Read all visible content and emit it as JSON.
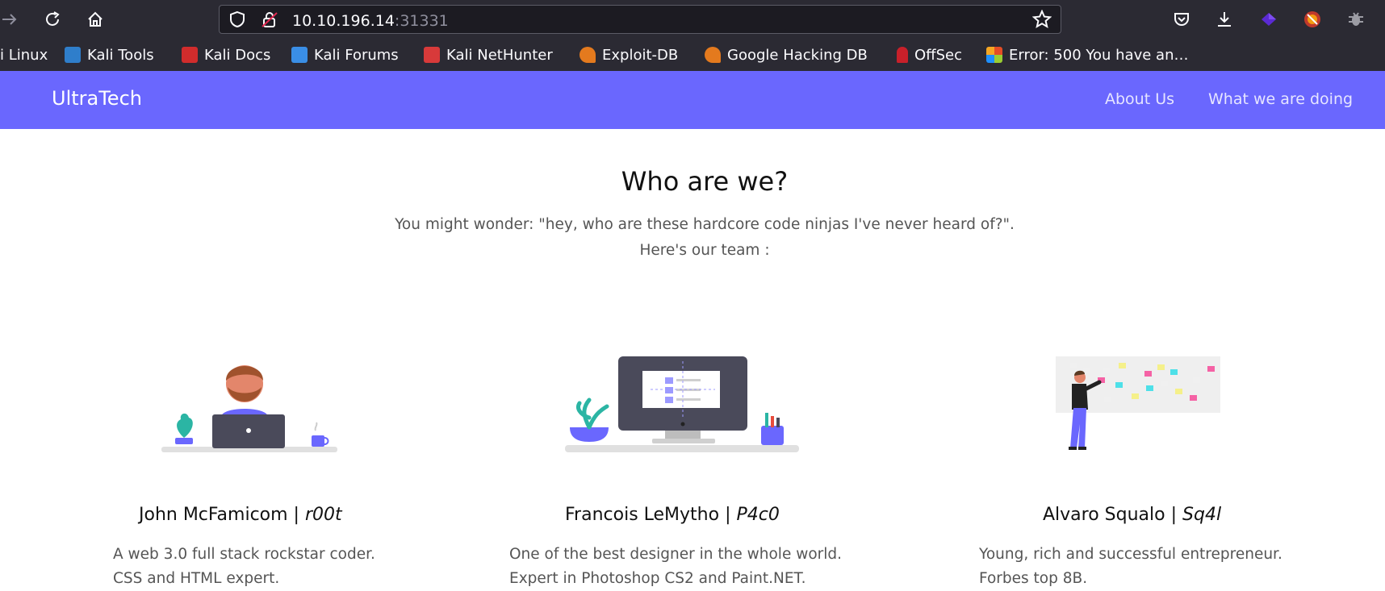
{
  "browser": {
    "url_host": "10.10.196.14",
    "url_port": ":31331"
  },
  "bookmarks": [
    {
      "label": "i Linux",
      "color": "#2b2a33"
    },
    {
      "label": "Kali Tools",
      "color": "#2f7ecb"
    },
    {
      "label": "Kali Docs",
      "color": "#d12c2c"
    },
    {
      "label": "Kali Forums",
      "color": "#3a8ee6"
    },
    {
      "label": "Kali NetHunter",
      "color": "#d83a3a"
    },
    {
      "label": "Exploit-DB",
      "color": "#e47a1e"
    },
    {
      "label": "Google Hacking DB",
      "color": "#e47a1e"
    },
    {
      "label": "OffSec",
      "color": "#c8202a"
    },
    {
      "label": "Error: 500 You have an…",
      "color": "#9acd32"
    }
  ],
  "site": {
    "brand": "UltraTech",
    "nav": [
      "About Us",
      "What we are doing"
    ],
    "accent": "#6a67fe"
  },
  "main": {
    "heading": "Who are we?",
    "lead_line1": "You might wonder: \"hey, who are these hardcore code ninjas I've never heard of?\".",
    "lead_line2": "Here's our team :"
  },
  "team": [
    {
      "name": "John McFamicom | ",
      "handle": "r00t",
      "desc_line1": "A web 3.0 full stack rockstar coder.",
      "desc_line2": "CSS and HTML expert."
    },
    {
      "name": "Francois LeMytho | ",
      "handle": "P4c0",
      "desc_line1": "One of the best designer in the whole world.",
      "desc_line2": "Expert in Photoshop CS2 and Paint.NET."
    },
    {
      "name": "Alvaro Squalo | ",
      "handle": "Sq4l",
      "desc_line1": "Young, rich and successful entrepreneur.",
      "desc_line2": "Forbes top 8B."
    }
  ]
}
